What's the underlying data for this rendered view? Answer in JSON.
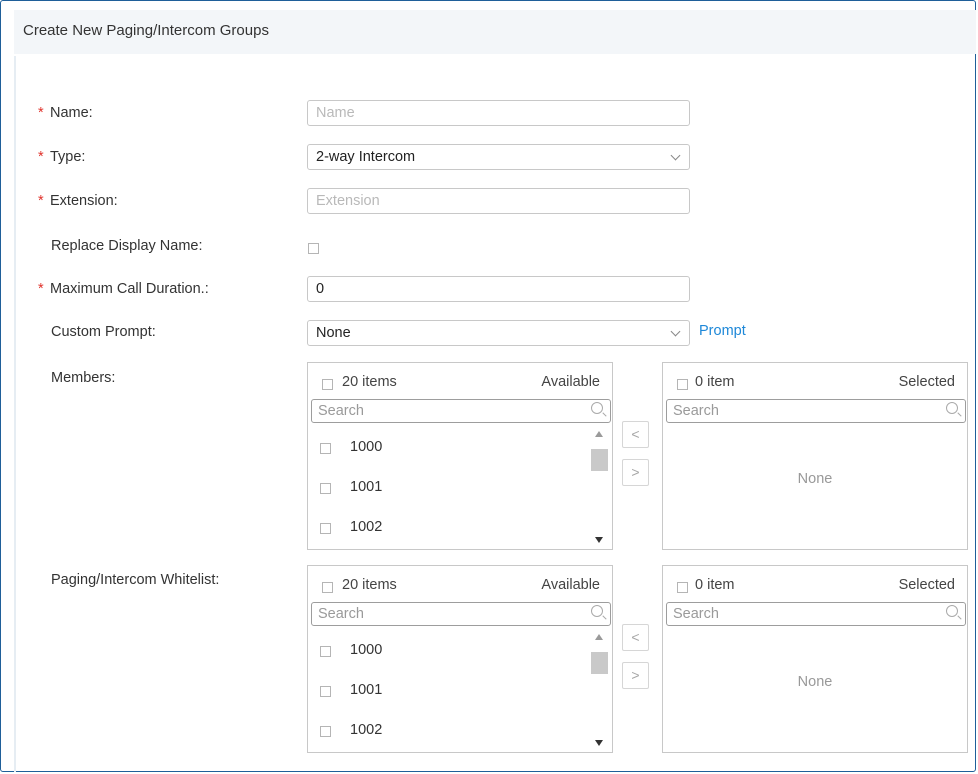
{
  "page": {
    "title": "Create New Paging/Intercom Groups"
  },
  "form": {
    "name": {
      "label": "Name:",
      "required": true,
      "placeholder": "Name",
      "value": ""
    },
    "type": {
      "label": "Type:",
      "required": true,
      "value": "2-way Intercom"
    },
    "extension": {
      "label": "Extension:",
      "required": true,
      "placeholder": "Extension",
      "value": ""
    },
    "replace_display_name": {
      "label": "Replace Display Name:",
      "checked": false
    },
    "max_call_duration": {
      "label": "Maximum Call Duration.:",
      "required": true,
      "value": "0"
    },
    "custom_prompt": {
      "label": "Custom Prompt:",
      "value": "None",
      "link": "Prompt"
    },
    "members": {
      "label": "Members:",
      "available": {
        "count_text": "20 items",
        "title": "Available",
        "search_placeholder": "Search",
        "items": [
          "1000",
          "1001",
          "1002"
        ]
      },
      "selected": {
        "count_text": "0 item",
        "title": "Selected",
        "search_placeholder": "Search",
        "empty_text": "None"
      }
    },
    "whitelist": {
      "label": "Paging/Intercom Whitelist:",
      "available": {
        "count_text": "20 items",
        "title": "Available",
        "search_placeholder": "Search",
        "items": [
          "1000",
          "1001",
          "1002"
        ]
      },
      "selected": {
        "count_text": "0 item",
        "title": "Selected",
        "search_placeholder": "Search",
        "empty_text": "None"
      }
    },
    "required_mark": "*",
    "transfer_buttons": {
      "left": "<",
      "right": ">"
    }
  },
  "colors": {
    "required": "#e0322b",
    "link": "#1e88d8",
    "frame": "#1f5f99"
  }
}
